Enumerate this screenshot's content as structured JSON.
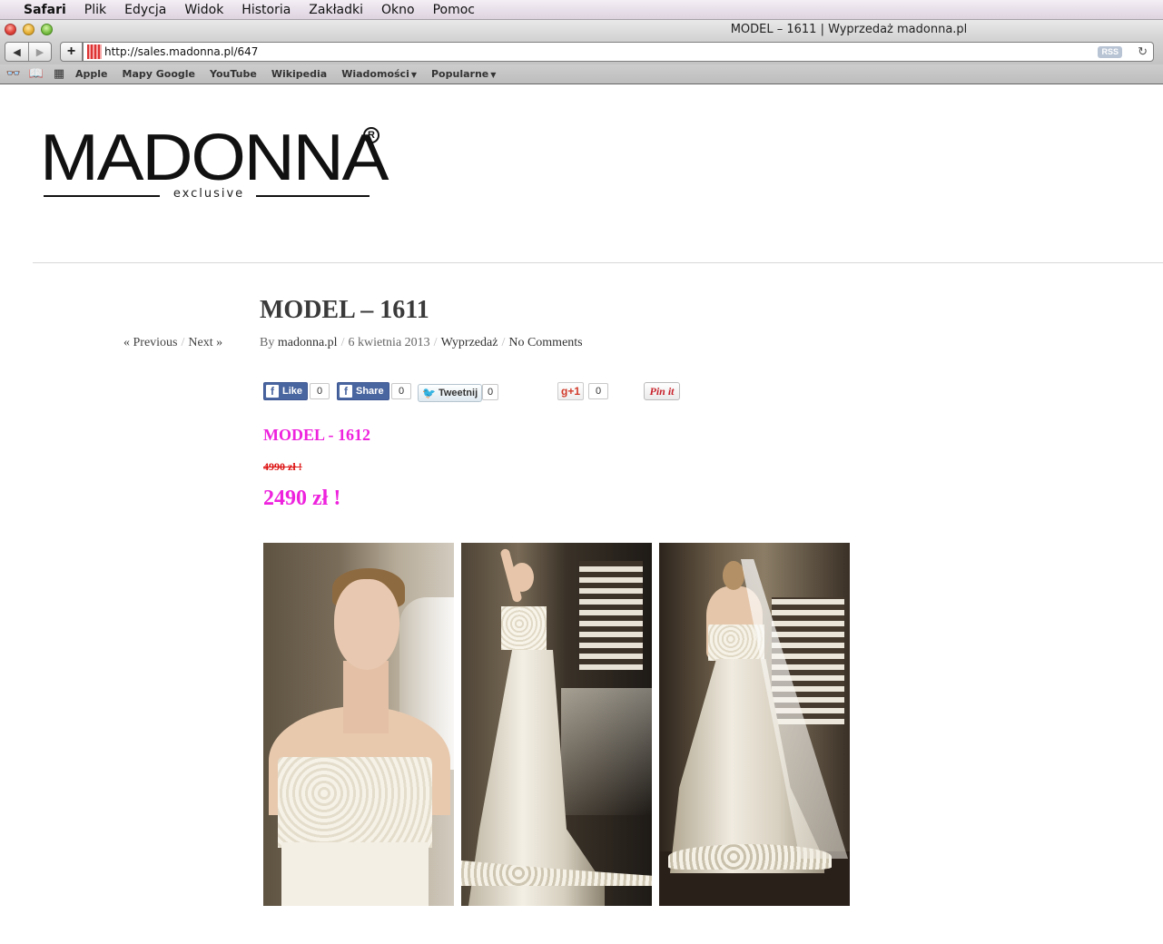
{
  "os_menubar": {
    "apple_icon": "apple-logo-icon",
    "items": [
      "Safari",
      "Plik",
      "Edycja",
      "Widok",
      "Historia",
      "Zakładki",
      "Okno",
      "Pomoc"
    ]
  },
  "window": {
    "title": "MODEL – 1611 | Wyprzedaż madonna.pl",
    "url": "http://sales.madonna.pl/647",
    "rss_label": "RSS"
  },
  "bookmarks": {
    "items": [
      {
        "label": "Apple"
      },
      {
        "label": "Mapy Google"
      },
      {
        "label": "YouTube"
      },
      {
        "label": "Wikipedia"
      },
      {
        "label": "Wiadomości"
      },
      {
        "label": "Popularne"
      }
    ]
  },
  "site": {
    "logo_text": "MADONNA",
    "logo_registered": "R",
    "logo_tagline": "exclusive"
  },
  "post": {
    "nav_previous": "« Previous",
    "nav_next": "Next »",
    "title": "MODEL – 1611",
    "by_label": "By",
    "author": "madonna.pl",
    "date": "6 kwietnia 2013",
    "category": "Wyprzedaż",
    "comments": "No Comments"
  },
  "social": {
    "fb_like_label": "Like",
    "fb_like_count": "0",
    "fb_share_label": "Share",
    "fb_share_count": "0",
    "tweet_label": "Tweetnij",
    "tweet_count": "0",
    "gplus_label": "g+1",
    "gplus_count": "0",
    "pinit_label": "Pin it"
  },
  "product": {
    "model": "MODEL - 1612",
    "old_price": "4990 zł !",
    "new_price": "2490 zł !",
    "accent_color": "#ee22dd",
    "old_price_color": "#dd1111"
  }
}
